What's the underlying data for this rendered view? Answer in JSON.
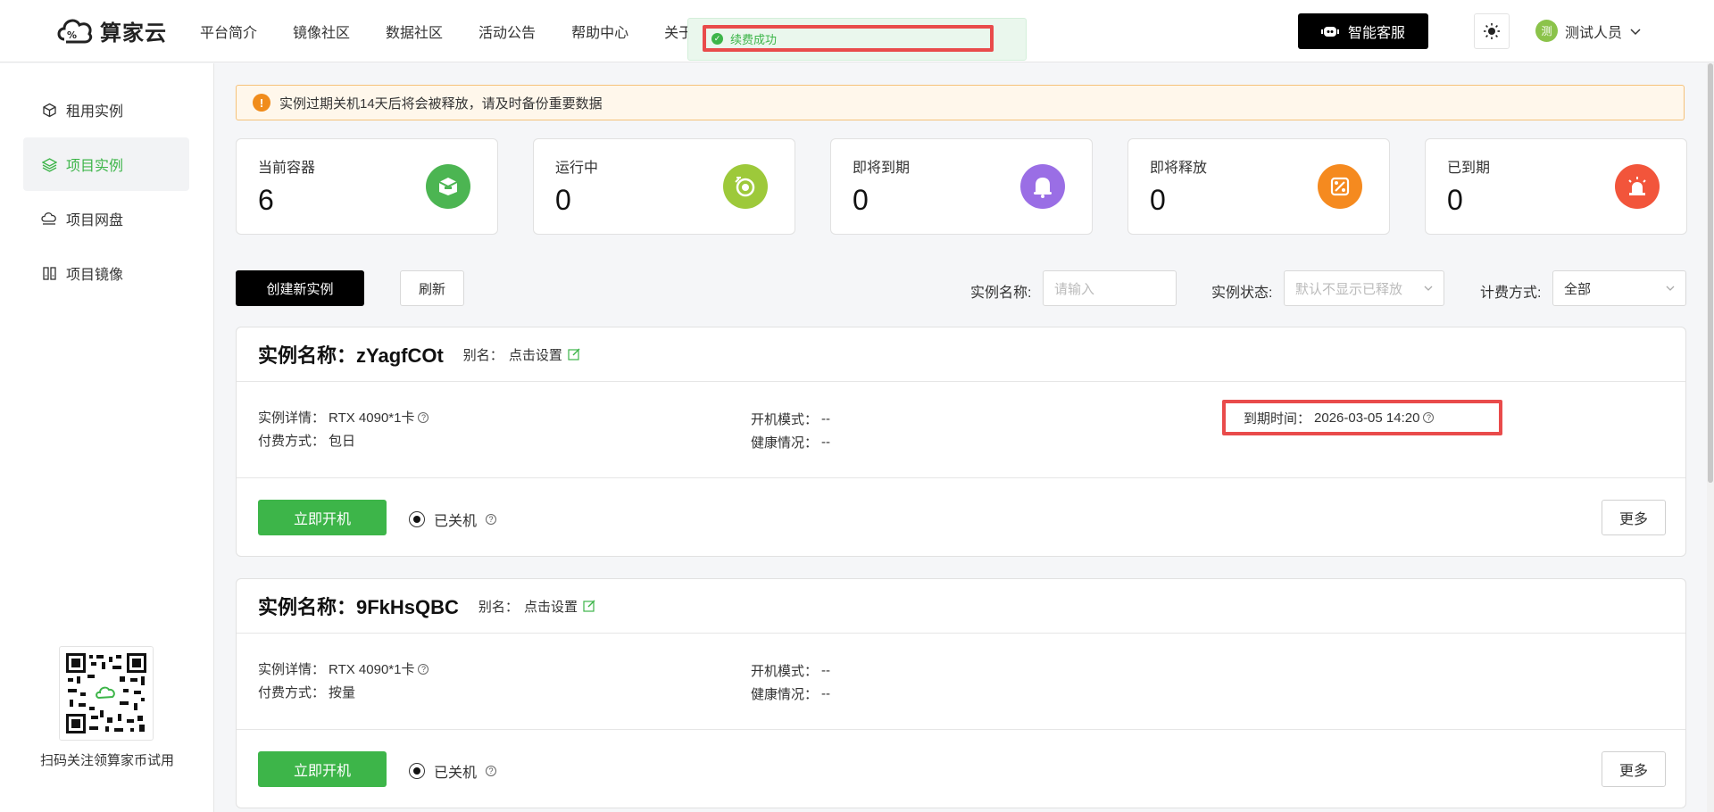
{
  "header": {
    "logo_text": "算家云",
    "nav": [
      "平台简介",
      "镜像社区",
      "数据社区",
      "活动公告",
      "帮助中心",
      "关于"
    ],
    "toast": "续费成功",
    "service_label": "智能客服",
    "user": {
      "avatar_text": "测",
      "name": "测试人员"
    }
  },
  "sidebar": {
    "items": [
      {
        "label": "租用实例",
        "icon": "cube-icon"
      },
      {
        "label": "项目实例",
        "icon": "layers-icon",
        "active": true
      },
      {
        "label": "项目网盘",
        "icon": "cloud-drive-icon"
      },
      {
        "label": "项目镜像",
        "icon": "image-icon"
      }
    ],
    "qr_caption": "扫码关注领算家币试用"
  },
  "notice": "实例过期关机14天后将会被释放，请及时备份重要数据",
  "stats": [
    {
      "label": "当前容器",
      "value": "6",
      "color": "#4cb552",
      "icon": "container-icon"
    },
    {
      "label": "运行中",
      "value": "0",
      "color": "#9dc93a",
      "icon": "running-icon"
    },
    {
      "label": "即将到期",
      "value": "0",
      "color": "#9a6ee5",
      "icon": "bell-icon"
    },
    {
      "label": "即将释放",
      "value": "0",
      "color": "#f58a1f",
      "icon": "release-icon"
    },
    {
      "label": "已到期",
      "value": "0",
      "color": "#f2553b",
      "icon": "alarm-icon"
    }
  ],
  "toolbar": {
    "create_label": "创建新实例",
    "refresh_label": "刷新",
    "name_label": "实例名称:",
    "name_placeholder": "请输入",
    "status_label": "实例状态:",
    "status_placeholder": "默认不显示已释放",
    "billing_label": "计费方式:",
    "billing_value": "全部"
  },
  "instances": [
    {
      "title": "实例名称：zYagfCOt",
      "alias_label": "别名：",
      "alias_value": "点击设置",
      "detail_label": "实例详情：",
      "detail_value": "RTX 4090*1卡",
      "pay_label": "付费方式：",
      "pay_value": "包日",
      "boot_label": "开机模式：",
      "boot_value": "--",
      "health_label": "健康情况：",
      "health_value": "--",
      "expire_label": "到期时间：",
      "expire_value": "2026-03-05 14:20",
      "start_label": "立即开机",
      "state_label": "已关机",
      "more_label": "更多"
    },
    {
      "title": "实例名称：9FkHsQBC",
      "alias_label": "别名：",
      "alias_value": "点击设置",
      "detail_label": "实例详情：",
      "detail_value": "RTX 4090*1卡",
      "pay_label": "付费方式：",
      "pay_value": "按量",
      "boot_label": "开机模式：",
      "boot_value": "--",
      "health_label": "健康情况：",
      "health_value": "--",
      "start_label": "立即开机",
      "state_label": "已关机",
      "more_label": "更多"
    }
  ]
}
